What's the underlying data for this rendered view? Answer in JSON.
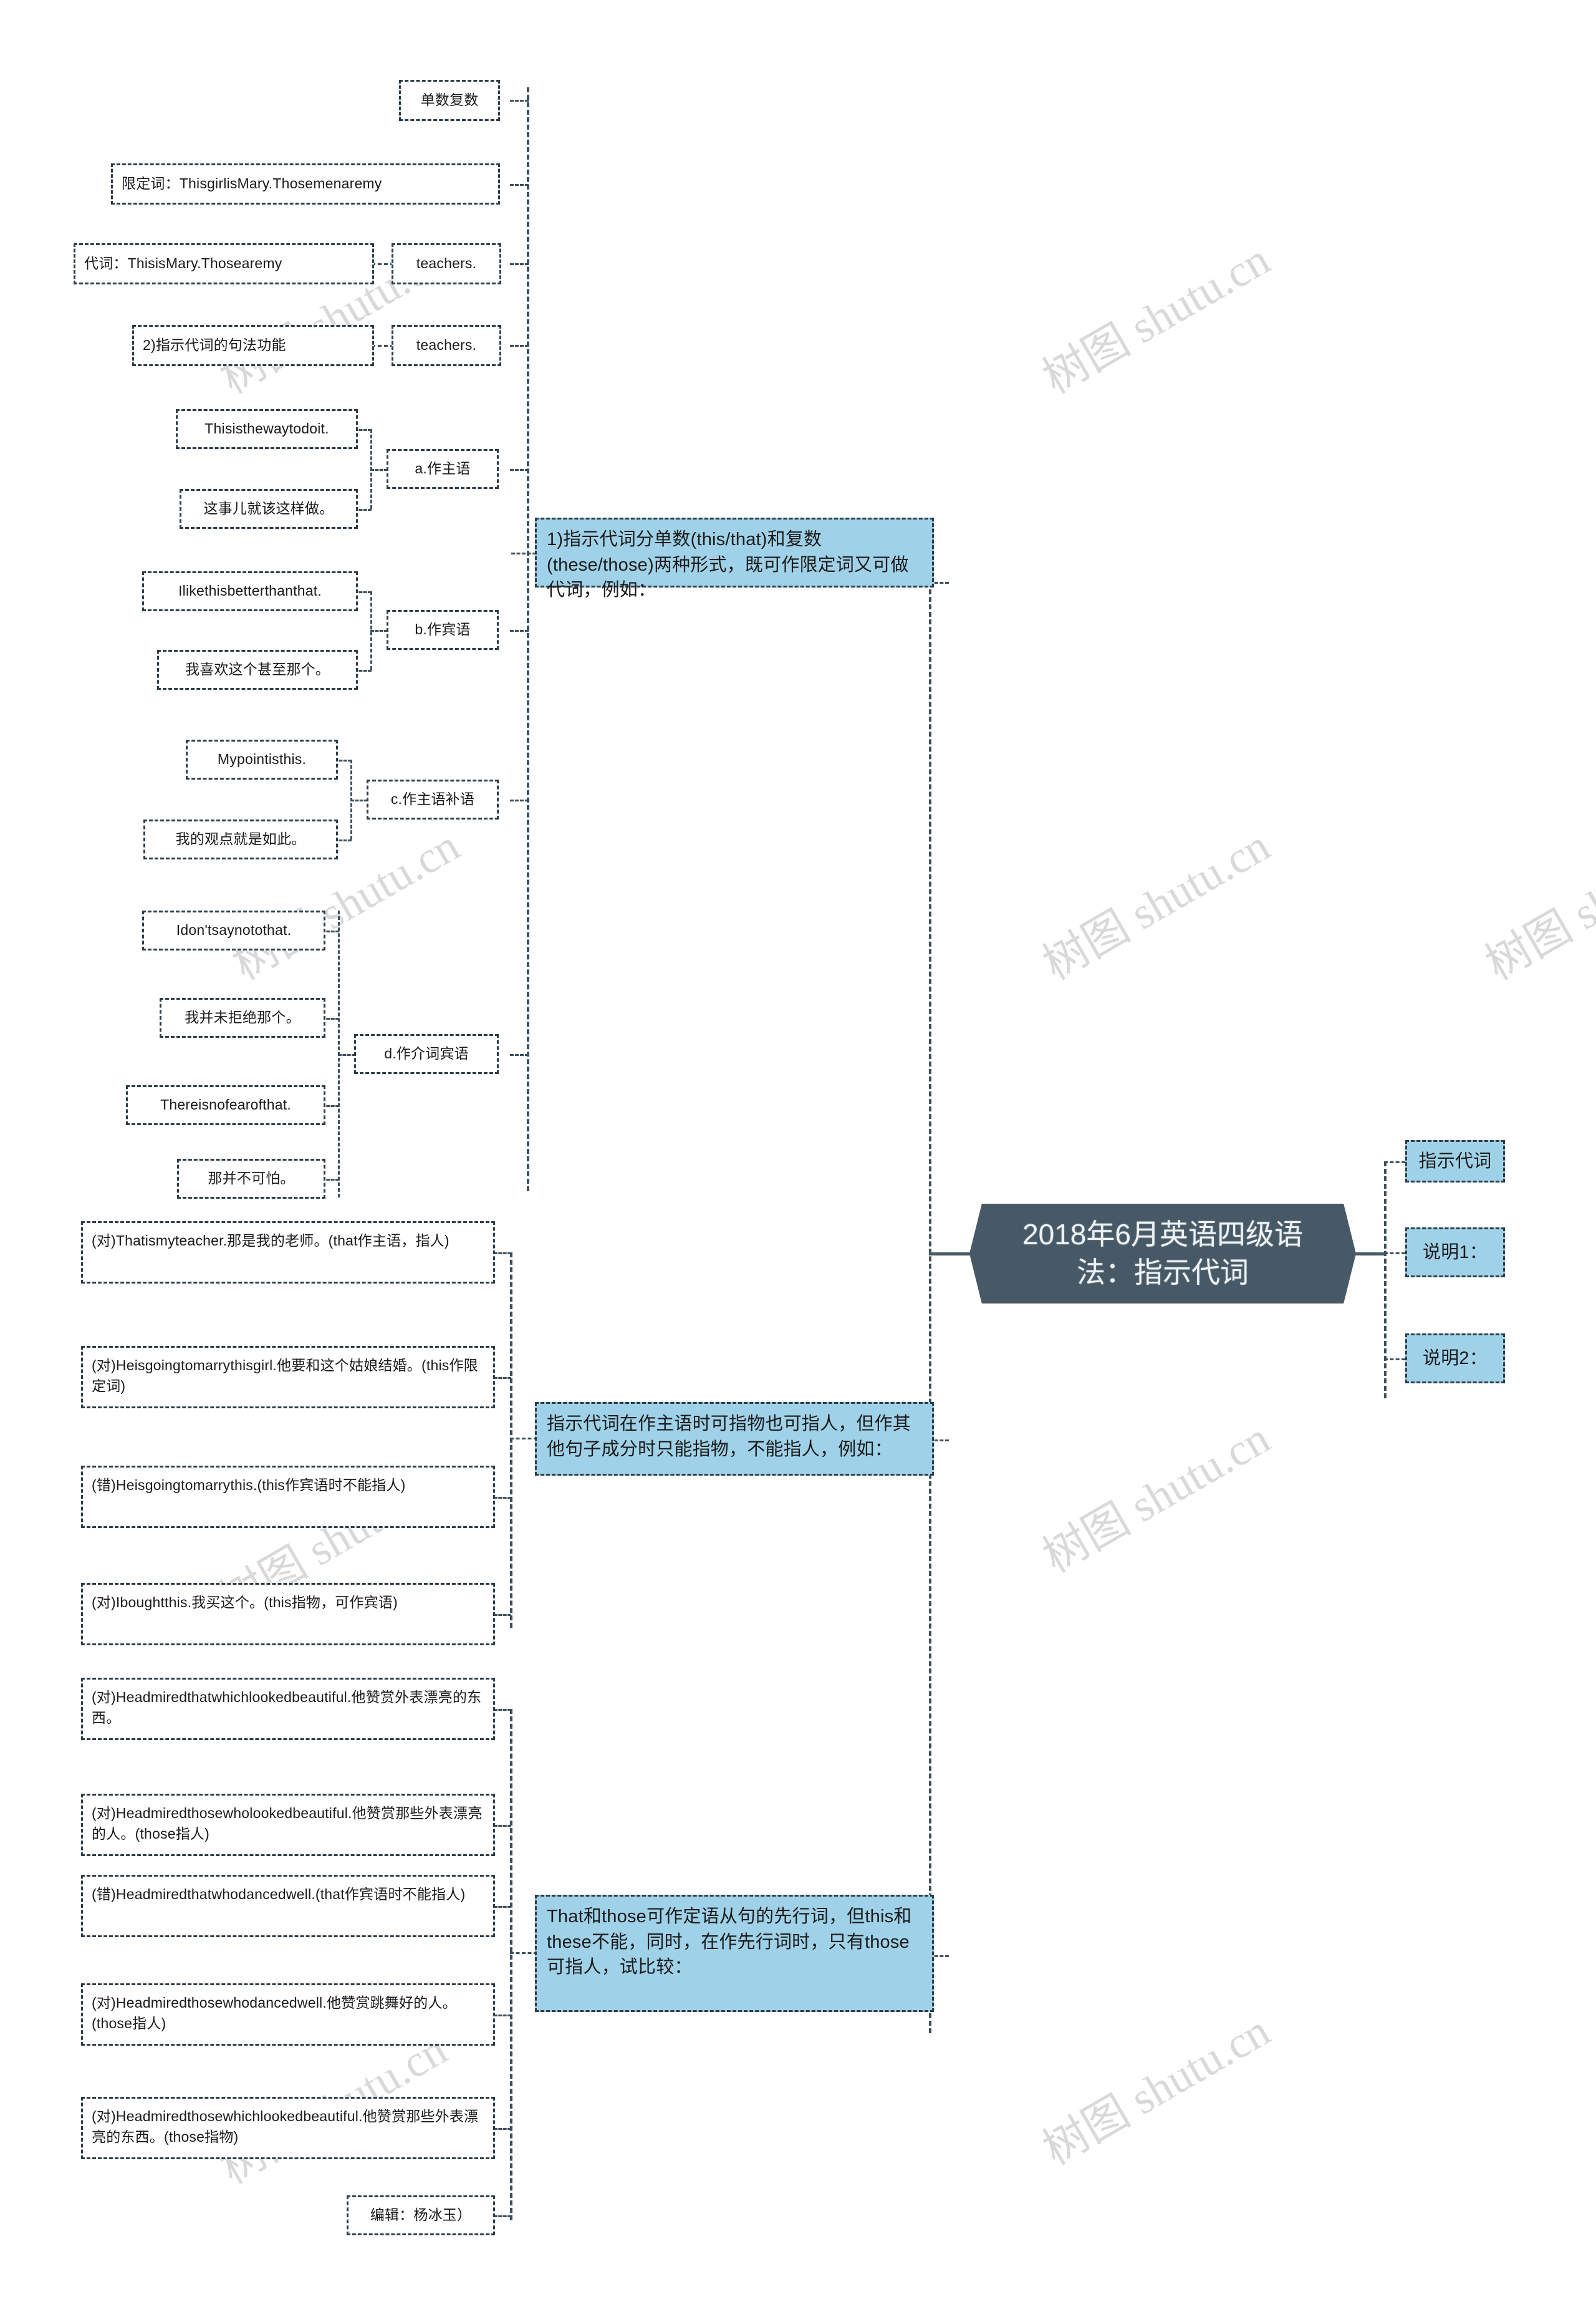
{
  "root": {
    "title": "2018年6月英语四级语法：指示代词"
  },
  "watermarks": [
    "树图 shutu.cn",
    "树图 shutu.cn",
    "树图 shutu.cn",
    "树图 shutu.cn",
    "树图 shutu.cn",
    "树图 shutu.cn",
    "树图 shutu.cn",
    "树图 shutu.cn",
    "树图 shutu.cn"
  ],
  "colors": {
    "accent_blue": "#9fd2e8",
    "root_dark": "#475966",
    "border": "#2e3c46",
    "background": "#ffffff",
    "watermark": "#d9d9d9"
  },
  "right_branch": {
    "items": [
      {
        "label": "指示代词"
      },
      {
        "label": "说明1："
      },
      {
        "label": "说明2："
      }
    ]
  },
  "summary_boxes": {
    "b1": "1)指示代词分单数(this/that)和复数(these/those)两种形式，既可作限定词又可做代词，例如：",
    "b2": "指示代词在作主语时可指物也可指人，但作其他句子成分时只能指物，不能指人，例如：",
    "b3": "That和those可作定语从句的先行词，但this和these不能，同时，在作先行词时，只有those可指人，试比较："
  },
  "branch1": {
    "title": "单数复数",
    "determiner": "限定词：ThisgirlisMary.Thosemenaremy",
    "determiner_tail": "teachers.",
    "pronoun": "代词：ThisisMary.Thosearemy",
    "pronoun_tail": "teachers.",
    "syntax_title": "2)指示代词的句法功能",
    "functions": [
      {
        "label": "a.作主语",
        "en": "Thisisthewaytodoit.",
        "zh": "这事儿就该这样做。"
      },
      {
        "label": "b.作宾语",
        "en": "Ilikethisbetterthanthat.",
        "zh": "我喜欢这个甚至那个。"
      },
      {
        "label": "c.作主语补语",
        "en": "Mypointisthis.",
        "zh": "我的观点就是如此。"
      },
      {
        "label": "d.作介词宾语",
        "en1": "Idon'tsaynotothat.",
        "zh1": "我并未拒绝那个。",
        "en2": "Thereisnofearofthat.",
        "zh2": "那并不可怕。"
      }
    ]
  },
  "branch2": {
    "examples": [
      "(对)Thatismyteacher.那是我的老师。(that作主语，指人)",
      "(对)Heisgoingtomarrythisgirl.他要和这个姑娘结婚。(this作限定词)",
      "(错)Heisgoingtomarrythis.(this作宾语时不能指人)",
      "(对)Iboughtthis.我买这个。(this指物，可作宾语)"
    ]
  },
  "branch3": {
    "examples": [
      "(对)Headmiredthatwhichlookedbeautiful.他赞赏外表漂亮的东西。",
      "(对)Headmiredthosewholookedbeautiful.他赞赏那些外表漂亮的人。(those指人)",
      "(错)Headmiredthatwhodancedwell.(that作宾语时不能指人)",
      "(对)Headmiredthosewhodancedwell.他赞赏跳舞好的人。(those指人)",
      "(对)Headmiredthosewhichlookedbeautiful.他赞赏那些外表漂亮的东西。(those指物)"
    ]
  },
  "footer": {
    "editor": "编辑：杨冰玉）"
  }
}
